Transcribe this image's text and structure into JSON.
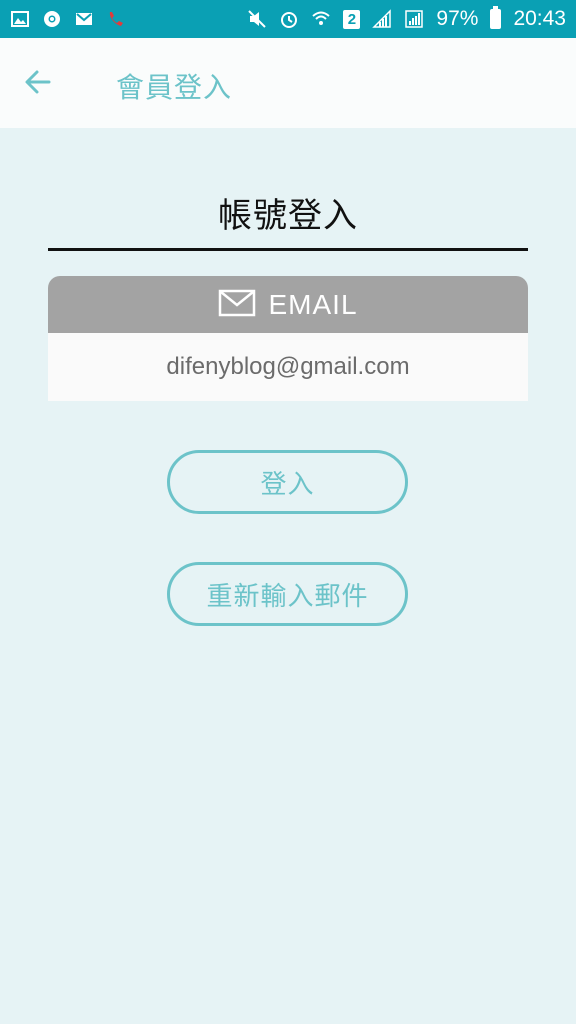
{
  "status_bar": {
    "battery_percent": "97%",
    "time": "20:43",
    "sim_badge": "2",
    "bg_color": "#0aa0b4"
  },
  "app_bar": {
    "title": "會員登入",
    "back_icon": "arrow-left-icon"
  },
  "main": {
    "section_title": "帳號登入",
    "email_card": {
      "header_label": "EMAIL",
      "header_icon": "envelope-icon",
      "value": "difenyblog@gmail.com"
    },
    "buttons": {
      "login_label": "登入",
      "resend_label": "重新輸入郵件"
    }
  },
  "colors": {
    "accent": "#6cc3c9",
    "background": "#e6f3f5",
    "card_header": "#a3a3a3"
  }
}
